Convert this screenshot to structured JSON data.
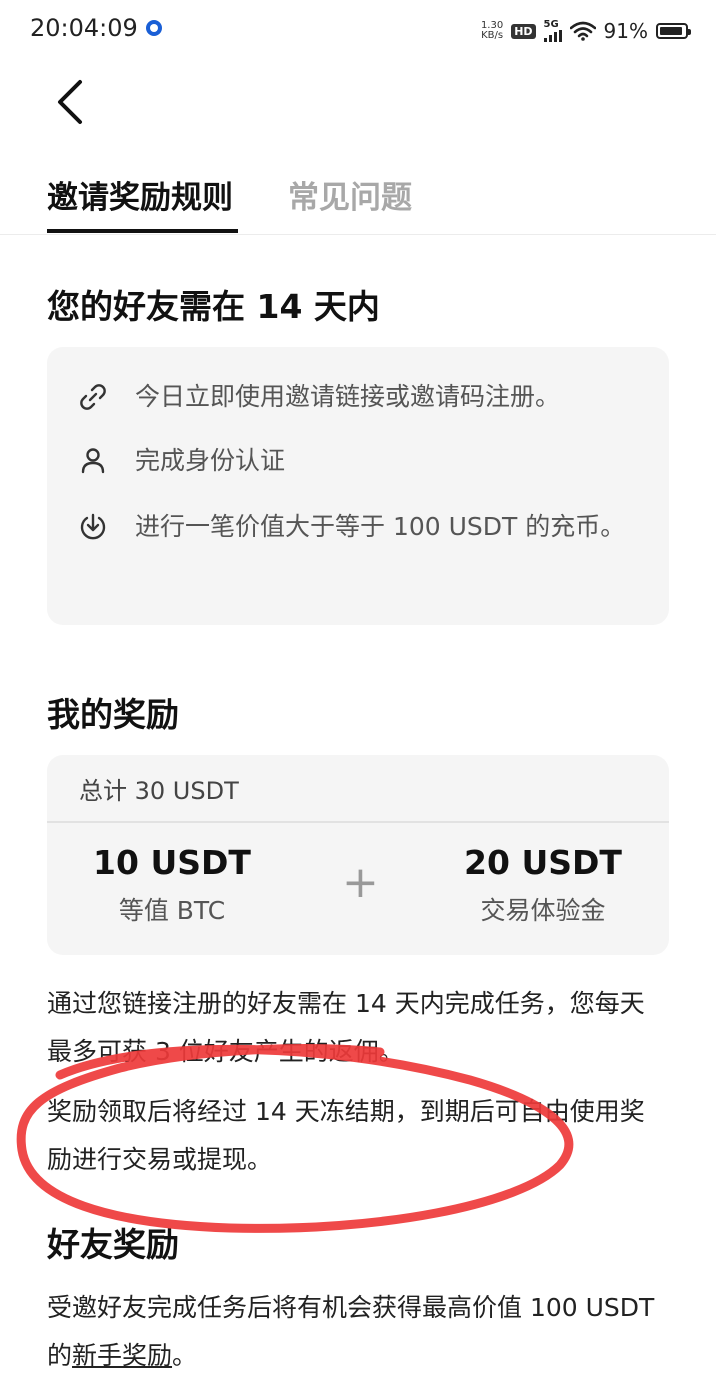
{
  "status_bar": {
    "time": "20:04:09",
    "net_speed_value": "1.30",
    "net_speed_unit": "KB/s",
    "hd_label": "HD",
    "network_type": "5G",
    "battery_percent": "91%"
  },
  "tabs": [
    {
      "label": "邀请奖励规则",
      "active": true
    },
    {
      "label": "常见问题",
      "active": false
    }
  ],
  "conditions": {
    "heading": "您的好友需在 14 天内",
    "items": [
      {
        "icon": "link-icon",
        "text": "今日立即使用邀请链接或邀请码注册。"
      },
      {
        "icon": "user-icon",
        "text": "完成身份认证"
      },
      {
        "icon": "deposit-icon",
        "text": "进行一笔价值大于等于 100 USDT 的充币。"
      }
    ]
  },
  "my_rewards": {
    "heading": "我的奖励",
    "total": "总计 30 USDT",
    "left_amount": "10 USDT",
    "left_label": "等值 BTC",
    "plus": "+",
    "right_amount": "20 USDT",
    "right_label": "交易体验金"
  },
  "notes": {
    "para1": "通过您链接注册的好友需在 14 天内完成任务，您每天最多可获 3 位好友产生的返佣。",
    "para2": "奖励领取后将经过 14 天冻结期，到期后可自由使用奖励进行交易或提现。"
  },
  "friend_rewards": {
    "heading": "好友奖励",
    "text_before": "受邀好友完成任务后将有机会获得最高价值 100 USDT 的",
    "link_text": "新手奖励",
    "text_after": "。"
  },
  "colors": {
    "card_bg": "#f5f5f5",
    "annotation_red": "#ee3a3a",
    "inactive_tab": "#a8a8a8"
  }
}
